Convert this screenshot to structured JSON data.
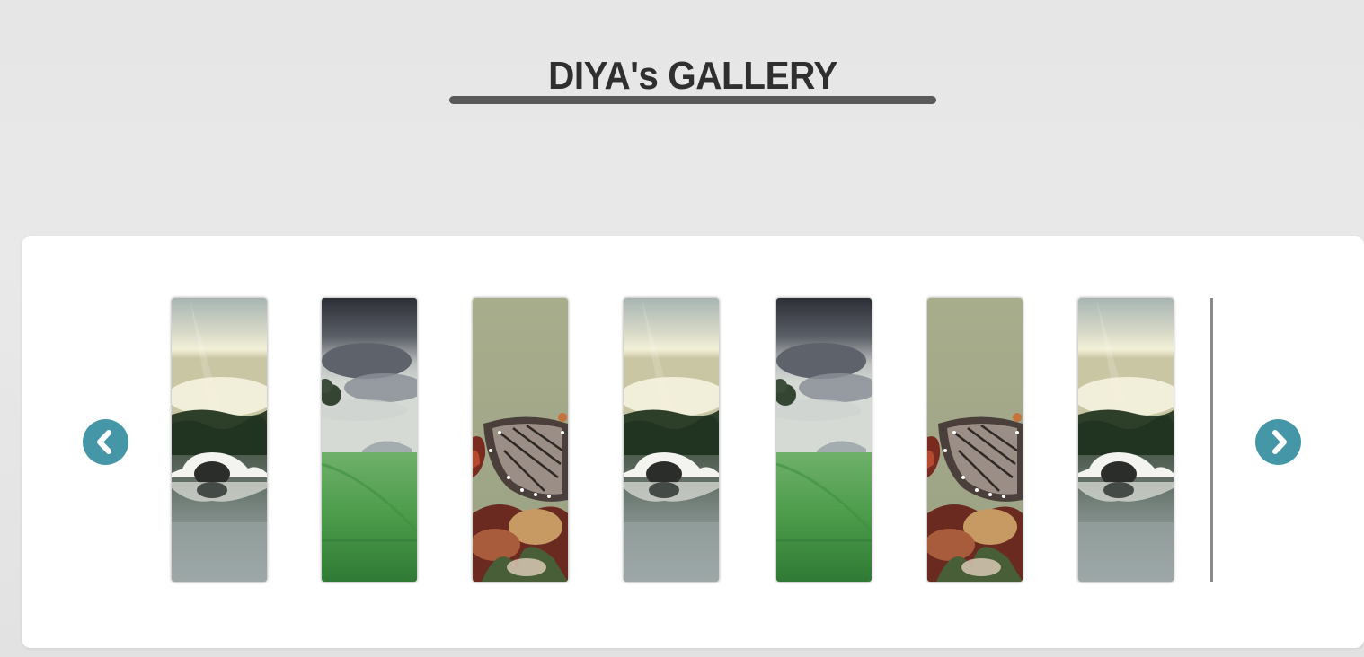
{
  "page": {
    "title": "DIYA's GALLERY"
  },
  "carousel": {
    "prev_icon": "chevron-left-icon",
    "next_icon": "chevron-right-icon",
    "accent_color": "#4597a8",
    "slides": [
      {
        "scene": "bridge"
      },
      {
        "scene": "field"
      },
      {
        "scene": "butterfly"
      },
      {
        "scene": "bridge"
      },
      {
        "scene": "field"
      },
      {
        "scene": "butterfly"
      },
      {
        "scene": "bridge"
      }
    ]
  }
}
